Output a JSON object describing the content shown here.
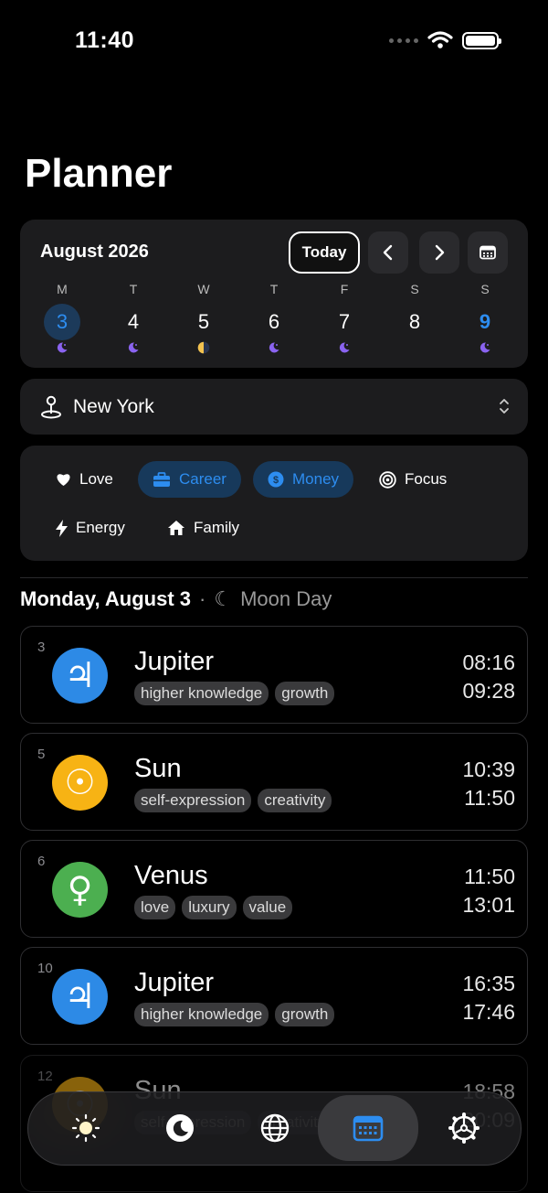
{
  "status": {
    "time": "11:40"
  },
  "page": {
    "title": "Planner"
  },
  "calendar": {
    "month": "August 2026",
    "today_label": "Today",
    "days": [
      {
        "letter": "M",
        "num": "3",
        "moon": "waxing-crescent",
        "state": "selected"
      },
      {
        "letter": "T",
        "num": "4",
        "moon": "waxing-crescent",
        "state": "normal"
      },
      {
        "letter": "W",
        "num": "5",
        "moon": "half-moon",
        "state": "normal"
      },
      {
        "letter": "T",
        "num": "6",
        "moon": "waxing-crescent",
        "state": "normal"
      },
      {
        "letter": "F",
        "num": "7",
        "moon": "waxing-crescent",
        "state": "normal"
      },
      {
        "letter": "S",
        "num": "8",
        "moon": "none",
        "state": "normal"
      },
      {
        "letter": "S",
        "num": "9",
        "moon": "waxing-crescent",
        "state": "highlight"
      }
    ]
  },
  "location": {
    "name": "New York"
  },
  "filters": [
    {
      "label": "Love",
      "icon": "heart-icon",
      "active": false
    },
    {
      "label": "Career",
      "icon": "briefcase-icon",
      "active": true
    },
    {
      "label": "Money",
      "icon": "dollar-coin-icon",
      "active": true
    },
    {
      "label": "Focus",
      "icon": "target-icon",
      "active": false
    },
    {
      "label": "Energy",
      "icon": "bolt-icon",
      "active": false
    },
    {
      "label": "Family",
      "icon": "house-icon",
      "active": false
    }
  ],
  "day_header": {
    "date": "Monday, August 3",
    "separator": "·",
    "moon_symbol": "☾",
    "moon_label": "Moon Day"
  },
  "hours": [
    {
      "hour": "3",
      "planet": "Jupiter",
      "symbol": "♃",
      "color": "#2d8ae6",
      "tags": [
        "higher knowledge",
        "growth"
      ],
      "start": "08:16",
      "end": "09:28"
    },
    {
      "hour": "5",
      "planet": "Sun",
      "symbol": "☉",
      "color": "#f7b314",
      "tags": [
        "self-expression",
        "creativity"
      ],
      "start": "10:39",
      "end": "11:50"
    },
    {
      "hour": "6",
      "planet": "Venus",
      "symbol": "♀",
      "color": "#4caf50",
      "tags": [
        "love",
        "luxury",
        "value"
      ],
      "start": "11:50",
      "end": "13:01"
    },
    {
      "hour": "10",
      "planet": "Jupiter",
      "symbol": "♃",
      "color": "#2d8ae6",
      "tags": [
        "higher knowledge",
        "growth"
      ],
      "start": "16:35",
      "end": "17:46"
    },
    {
      "hour": "12",
      "planet": "Sun",
      "symbol": "☉",
      "color": "#f7b314",
      "tags": [
        "self-expression",
        "creativity"
      ],
      "start": "18:58",
      "end": "20:09"
    }
  ],
  "tabbar": {
    "tabs": [
      {
        "name": "sun-tab",
        "icon": "sun-icon",
        "active": false
      },
      {
        "name": "moon-tab",
        "icon": "moon-icon",
        "active": false
      },
      {
        "name": "globe-tab",
        "icon": "globe-icon",
        "active": false
      },
      {
        "name": "planner-tab",
        "icon": "calendar-icon",
        "active": true
      },
      {
        "name": "settings-tab",
        "icon": "gear-icon",
        "active": false
      }
    ]
  },
  "colors": {
    "accent": "#2d8df0",
    "card": "#1c1c1e",
    "moon": "#8a63f0",
    "halfmoon": "#f3c24f"
  }
}
